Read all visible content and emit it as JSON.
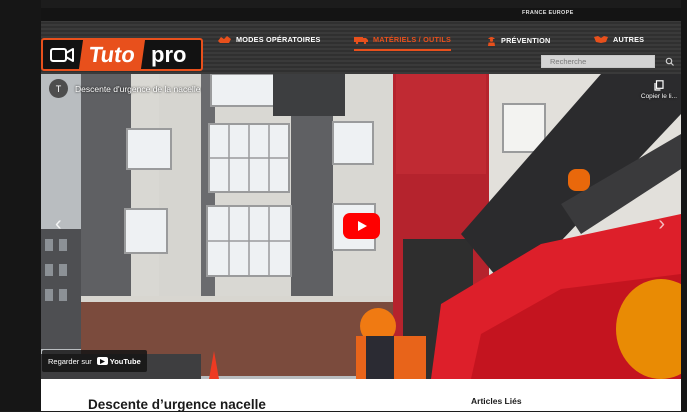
{
  "header": {
    "region": "FRANCE EUROPE",
    "logo": {
      "word1": "Tuto",
      "word2": "pro"
    },
    "nav": [
      {
        "label": "MODES OPÉRATOIRES",
        "icon": "hands-icon",
        "active": false
      },
      {
        "label": "MATÉRIELS / OUTILS",
        "icon": "truck-icon",
        "active": true
      },
      {
        "label": "PRÉVENTION",
        "icon": "worker-icon",
        "active": false
      },
      {
        "label": "AUTRES",
        "icon": "handshake-icon",
        "active": false
      }
    ],
    "search": {
      "placeholder": "Recherche"
    }
  },
  "video": {
    "channel_initial": "T",
    "title": "Descente d'urgence de la nacelle",
    "copy_label": "Copier le li...",
    "watch_label": "Regarder sur",
    "youtube_label": "YouTube"
  },
  "content": {
    "page_title": "Descente d’urgence nacelle",
    "related_title": "Articles Liés"
  },
  "colors": {
    "accent": "#e8501c",
    "youtube_red": "#ff0000"
  }
}
